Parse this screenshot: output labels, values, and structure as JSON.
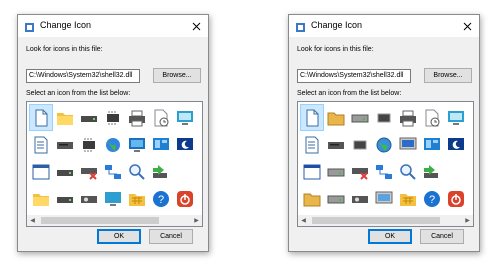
{
  "dialogs": [
    {
      "title": "Change Icon",
      "look_label": "Look for icons in this file:",
      "path_value": "C:\\Windows\\System32\\shell32.dll",
      "browse_label": "Browse...",
      "select_label": "Select an icon from the list below:",
      "ok_label": "OK",
      "cancel_label": "Cancel",
      "style": "flat",
      "selected_index": 0,
      "icons": [
        "blank-document",
        "folder",
        "drive",
        "chip",
        "printer",
        "clock-document",
        "monitor-image",
        "text-document",
        "floppy-drive",
        "chip",
        "globe",
        "network-monitor",
        "control-panel",
        "moon-monitor",
        "window",
        "drive",
        "network-drive-x",
        "network",
        "magnifier",
        "green-arrow",
        "",
        "folder",
        "drive",
        "cd-drive",
        "monitor",
        "folder-grid",
        "help",
        "power"
      ]
    },
    {
      "title": "Change Icon",
      "look_label": "Look for icons in this file:",
      "path_value": "C:\\Windows\\System32\\shell32.dll",
      "browse_label": "Browse...",
      "select_label": "Select an icon from the list below:",
      "ok_label": "OK",
      "cancel_label": "Cancel",
      "style": "classic",
      "selected_index": 0,
      "icons": [
        "blank-document",
        "folder",
        "drive",
        "chip",
        "printer",
        "clock-document",
        "monitor-image",
        "text-document",
        "floppy-drive",
        "chip",
        "globe",
        "network-monitor",
        "control-panel",
        "moon-monitor",
        "window",
        "drive",
        "network-drive-x",
        "network",
        "magnifier",
        "green-arrow",
        "",
        "folder",
        "drive",
        "cd-drive",
        "monitor",
        "folder-grid",
        "help",
        "power"
      ]
    }
  ],
  "colors": {
    "accent": "#0078d7",
    "selection": "#cce8ff",
    "dialog_bg": "#f0f0f0"
  }
}
